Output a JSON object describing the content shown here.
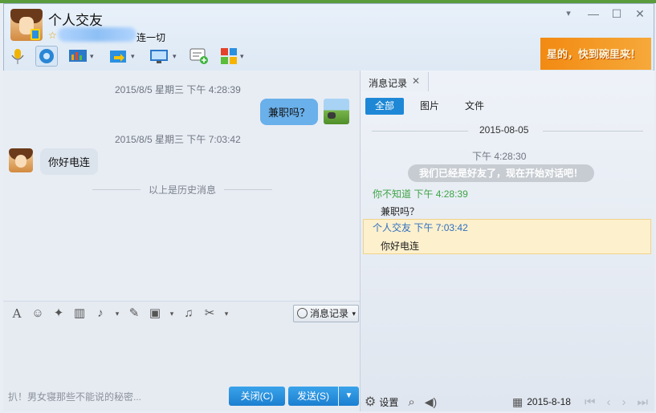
{
  "window": {
    "title": "个人交友",
    "signature": "连一切"
  },
  "controls": {
    "dropdown": "▾",
    "minimize": "—",
    "maximize": "☐",
    "close": "✕"
  },
  "toolbar_icons": [
    "microphone-icon",
    "webcam-icon",
    "share-screen-icon",
    "file-transfer-icon",
    "remote-desktop-icon",
    "message-icon",
    "apps-icon"
  ],
  "ad": {
    "text": "星的，快到碗里来！"
  },
  "chat": {
    "messages": [
      {
        "time": "2015/8/5 星期三 下午 4:28:39",
        "text": "兼职吗？",
        "side": "right"
      },
      {
        "time": "2015/8/5 星期三 下午 7:03:42",
        "text": "你好电连",
        "side": "left"
      }
    ],
    "history_divider": "以上是历史消息"
  },
  "format_bar": {
    "message_history_button": "消息记录"
  },
  "input": {
    "placeholder": "扒！男女寝那些不能说的秘密..."
  },
  "buttons": {
    "close": "关闭(C)",
    "send": "发送(S)"
  },
  "history_panel": {
    "tab_title": "消息记录",
    "filters": [
      "全部",
      "图片",
      "文件"
    ],
    "date": "2015-08-05",
    "system_time": "下午 4:28:30",
    "system_msg": "我们已经是好友了，现在开始对话吧！",
    "entries": [
      {
        "sender": "你不知道",
        "time": "4:28:39",
        "prefix": "下午",
        "text": "兼职吗？",
        "color": "#3ea346"
      },
      {
        "sender": "个人交友",
        "time": "7:03:42",
        "prefix": "下午",
        "text": "你好电连",
        "color": "#2e6fc1"
      }
    ],
    "footer": {
      "settings": "设置",
      "date": "2015-8-18"
    }
  },
  "colors": {
    "accent": "#1e88d6",
    "bubble_self": "#6ab0ea",
    "highlight": "#fdf0cd"
  }
}
